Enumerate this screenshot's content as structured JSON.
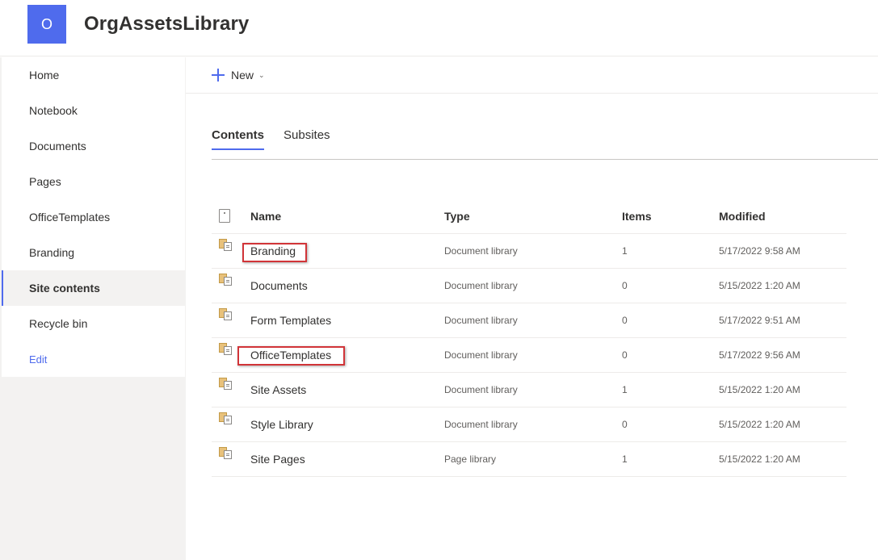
{
  "site": {
    "logo_letter": "O",
    "title": "OrgAssetsLibrary",
    "accent": "#4f6bed"
  },
  "nav": {
    "items": [
      {
        "label": "Home"
      },
      {
        "label": "Notebook"
      },
      {
        "label": "Documents"
      },
      {
        "label": "Pages"
      },
      {
        "label": "OfficeTemplates"
      },
      {
        "label": "Branding"
      },
      {
        "label": "Site contents",
        "selected": true
      },
      {
        "label": "Recycle bin"
      }
    ],
    "edit_label": "Edit"
  },
  "commandbar": {
    "new_label": "New",
    "new_icon": "plus-icon",
    "dropdown_icon": "chevron-down-icon"
  },
  "tabs": [
    {
      "label": "Contents",
      "active": true
    },
    {
      "label": "Subsites"
    }
  ],
  "table": {
    "headers": {
      "name": "Name",
      "type": "Type",
      "items": "Items",
      "modified": "Modified"
    },
    "rows": [
      {
        "name": "Branding",
        "type": "Document library",
        "items": "1",
        "modified": "5/17/2022 9:58 AM",
        "highlighted": true
      },
      {
        "name": "Documents",
        "type": "Document library",
        "items": "0",
        "modified": "5/15/2022 1:20 AM"
      },
      {
        "name": "Form Templates",
        "type": "Document library",
        "items": "0",
        "modified": "5/17/2022 9:51 AM"
      },
      {
        "name": "OfficeTemplates",
        "type": "Document library",
        "items": "0",
        "modified": "5/17/2022 9:56 AM",
        "highlighted": true
      },
      {
        "name": "Site Assets",
        "type": "Document library",
        "items": "1",
        "modified": "5/15/2022 1:20 AM"
      },
      {
        "name": "Style Library",
        "type": "Document library",
        "items": "0",
        "modified": "5/15/2022 1:20 AM"
      },
      {
        "name": "Site Pages",
        "type": "Page library",
        "items": "1",
        "modified": "5/15/2022 1:20 AM"
      }
    ]
  },
  "highlight_color": "#d13438"
}
